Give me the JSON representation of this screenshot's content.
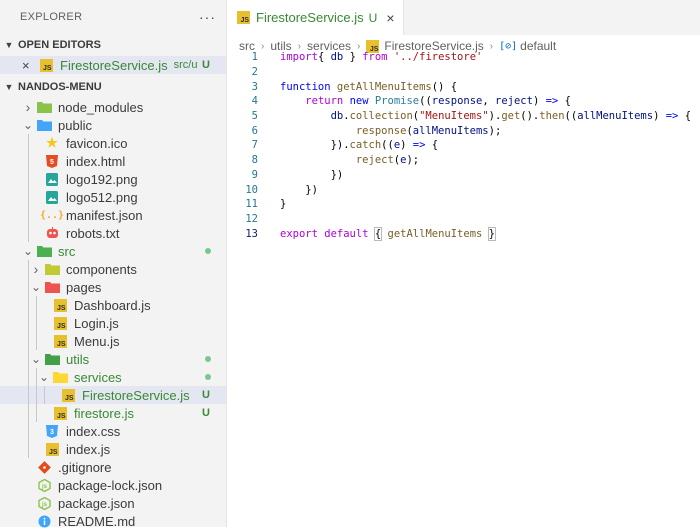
{
  "explorer": {
    "title": "EXPLORER",
    "more": "···",
    "open_editors": {
      "title": "OPEN EDITORS",
      "items": [
        {
          "name": "FirestoreService.js",
          "path": "src/utils/...",
          "badge": "U"
        }
      ]
    },
    "project": {
      "title": "NANDOS-MENU",
      "tree": [
        {
          "name": "node_modules",
          "type": "folder",
          "depth": 0,
          "collapsed": true,
          "icon": "node-folder-icon"
        },
        {
          "name": "public",
          "type": "folder",
          "depth": 0,
          "collapsed": false,
          "icon": "public-folder-icon"
        },
        {
          "name": "favicon.ico",
          "type": "file",
          "depth": 1,
          "icon": "star-icon"
        },
        {
          "name": "index.html",
          "type": "file",
          "depth": 1,
          "icon": "html5-icon"
        },
        {
          "name": "logo192.png",
          "type": "file",
          "depth": 1,
          "icon": "image-icon"
        },
        {
          "name": "logo512.png",
          "type": "file",
          "depth": 1,
          "icon": "image-icon"
        },
        {
          "name": "manifest.json",
          "type": "file",
          "depth": 1,
          "icon": "json-braces-icon"
        },
        {
          "name": "robots.txt",
          "type": "file",
          "depth": 1,
          "icon": "robot-icon"
        },
        {
          "name": "src",
          "type": "folder",
          "depth": 0,
          "collapsed": false,
          "status": "dot",
          "green": true,
          "icon": "src-folder-icon"
        },
        {
          "name": "components",
          "type": "folder",
          "depth": 1,
          "collapsed": true,
          "icon": "components-folder-icon"
        },
        {
          "name": "pages",
          "type": "folder",
          "depth": 1,
          "collapsed": false,
          "icon": "pages-folder-icon"
        },
        {
          "name": "Dashboard.js",
          "type": "file",
          "depth": 2,
          "icon": "js-icon"
        },
        {
          "name": "Login.js",
          "type": "file",
          "depth": 2,
          "icon": "js-icon"
        },
        {
          "name": "Menu.js",
          "type": "file",
          "depth": 2,
          "icon": "js-icon"
        },
        {
          "name": "utils",
          "type": "folder",
          "depth": 1,
          "collapsed": false,
          "status": "dot",
          "green": true,
          "icon": "utils-folder-icon"
        },
        {
          "name": "services",
          "type": "folder",
          "depth": 2,
          "collapsed": false,
          "status": "dot",
          "green": true,
          "icon": "services-folder-icon"
        },
        {
          "name": "FirestoreService.js",
          "type": "file",
          "depth": 3,
          "status": "U",
          "green": true,
          "selected": true,
          "icon": "js-icon"
        },
        {
          "name": "firestore.js",
          "type": "file",
          "depth": 2,
          "status": "U",
          "green": true,
          "icon": "js-icon"
        },
        {
          "name": "index.css",
          "type": "file",
          "depth": 1,
          "icon": "css-icon"
        },
        {
          "name": "index.js",
          "type": "file",
          "depth": 1,
          "icon": "js-icon"
        },
        {
          "name": ".gitignore",
          "type": "file",
          "depth": 0,
          "icon": "git-icon"
        },
        {
          "name": "package-lock.json",
          "type": "file",
          "depth": 0,
          "icon": "node-package-icon"
        },
        {
          "name": "package.json",
          "type": "file",
          "depth": 0,
          "icon": "node-package-icon"
        },
        {
          "name": "README.md",
          "type": "file",
          "depth": 0,
          "icon": "info-icon"
        }
      ]
    }
  },
  "editor": {
    "tab": {
      "label": "FirestoreService.js",
      "badge": "U",
      "close": "×"
    },
    "breadcrumbs": [
      "src",
      "utils",
      "services",
      "FirestoreService.js",
      "default"
    ],
    "active_line": 13,
    "lines": [
      [
        [
          "kw",
          "import"
        ],
        [
          "",
          "{ "
        ],
        [
          "var",
          "db"
        ],
        [
          "",
          " } "
        ],
        [
          "kw",
          "from"
        ],
        [
          "",
          " "
        ],
        [
          "str",
          "'../firestore'"
        ]
      ],
      [],
      [
        [
          "kb",
          "function"
        ],
        [
          "",
          " "
        ],
        [
          "fn",
          "getAllMenuItems"
        ],
        [
          "",
          "() {"
        ]
      ],
      [
        [
          "",
          "    "
        ],
        [
          "kw",
          "return"
        ],
        [
          "",
          " "
        ],
        [
          "kb",
          "new"
        ],
        [
          "",
          " "
        ],
        [
          "cls",
          "Promise"
        ],
        [
          "",
          "(("
        ],
        [
          "var",
          "response"
        ],
        [
          "",
          ", "
        ],
        [
          "var",
          "reject"
        ],
        [
          "",
          ") "
        ],
        [
          "kb",
          "=>"
        ],
        [
          "",
          " {"
        ]
      ],
      [
        [
          "",
          "        "
        ],
        [
          "var",
          "db"
        ],
        [
          "",
          "."
        ],
        [
          "fn",
          "collection"
        ],
        [
          "",
          "("
        ],
        [
          "str",
          "\"MenuItems\""
        ],
        [
          "",
          ")."
        ],
        [
          "fn",
          "get"
        ],
        [
          "",
          "()."
        ],
        [
          "fn",
          "then"
        ],
        [
          "",
          "(("
        ],
        [
          "var",
          "allMenuItems"
        ],
        [
          "",
          ") "
        ],
        [
          "kb",
          "=>"
        ],
        [
          "",
          " {"
        ]
      ],
      [
        [
          "",
          "            "
        ],
        [
          "fn",
          "response"
        ],
        [
          "",
          "("
        ],
        [
          "var",
          "allMenuItems"
        ],
        [
          "",
          ");"
        ]
      ],
      [
        [
          "",
          "        })."
        ],
        [
          "fn",
          "catch"
        ],
        [
          "",
          "(("
        ],
        [
          "var",
          "e"
        ],
        [
          "",
          ") "
        ],
        [
          "kb",
          "=>"
        ],
        [
          "",
          " {"
        ]
      ],
      [
        [
          "",
          "            "
        ],
        [
          "fn",
          "reject"
        ],
        [
          "",
          "("
        ],
        [
          "var",
          "e"
        ],
        [
          "",
          ");"
        ]
      ],
      [
        [
          "",
          "        })"
        ]
      ],
      [
        [
          "",
          "    })"
        ]
      ],
      [
        [
          "",
          "}"
        ]
      ],
      [],
      [
        [
          "kw",
          "export"
        ],
        [
          "",
          " "
        ],
        [
          "kw",
          "default"
        ],
        [
          "",
          " "
        ],
        [
          "box",
          "{"
        ],
        [
          "",
          " "
        ],
        [
          "fn",
          "getAllMenuItems"
        ],
        [
          "",
          " "
        ],
        [
          "box",
          "}"
        ]
      ]
    ]
  }
}
